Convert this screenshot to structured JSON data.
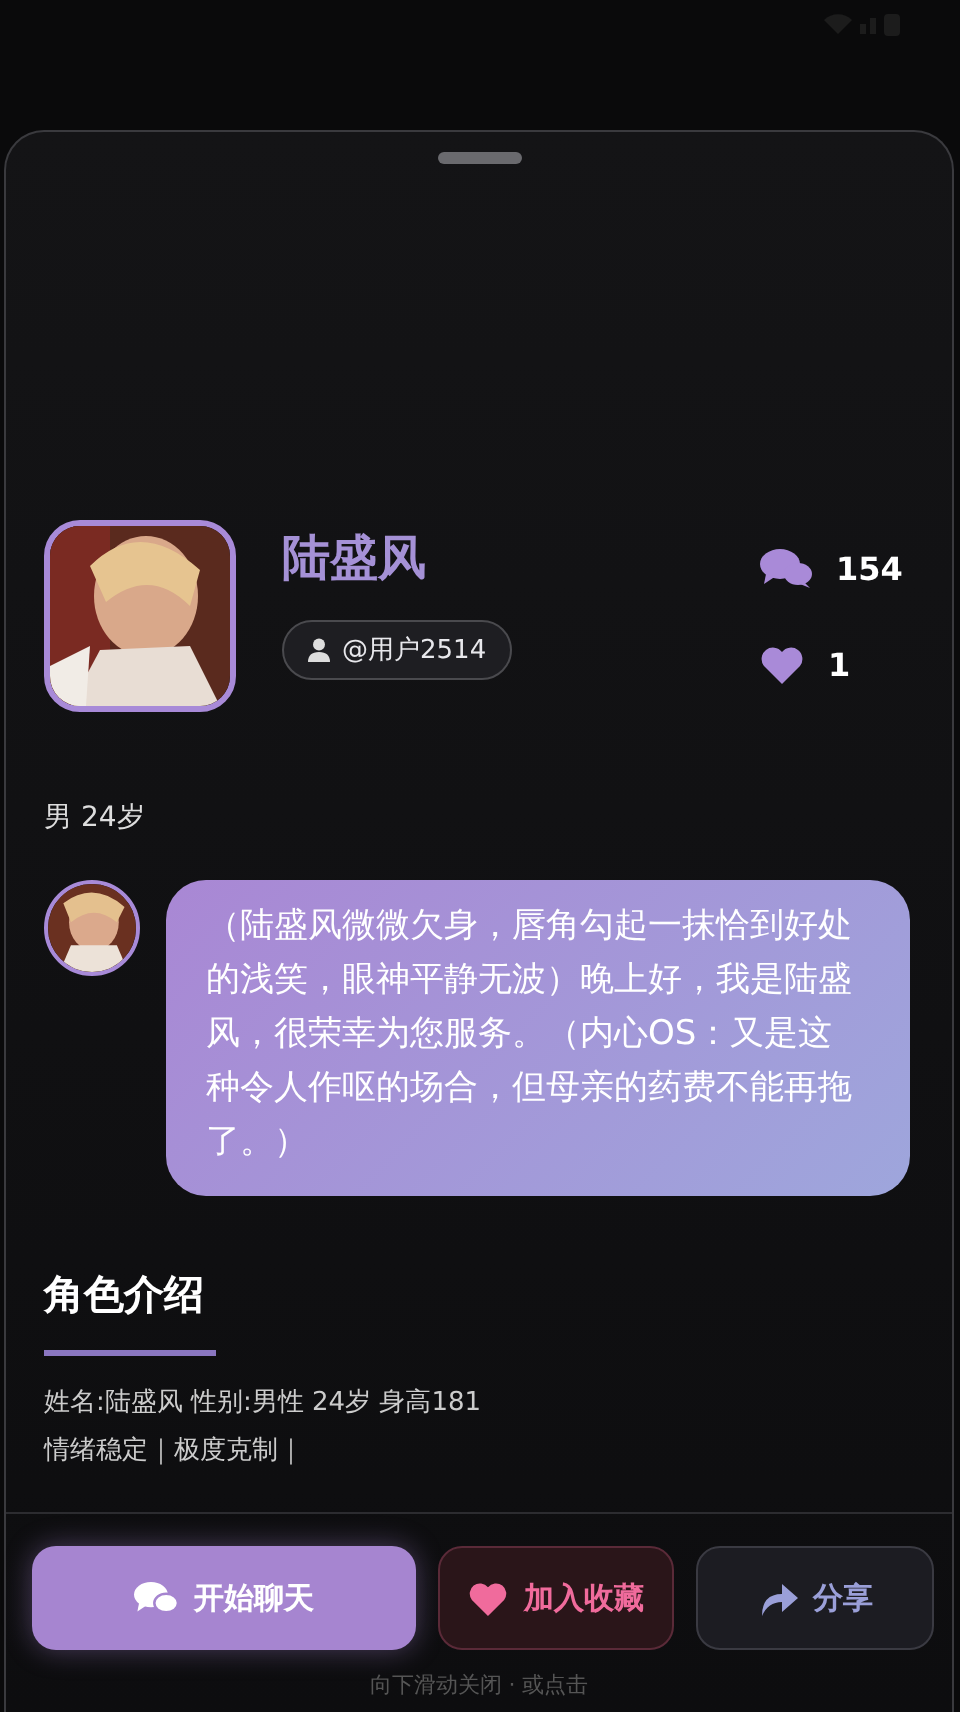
{
  "profile": {
    "name": "陆盛风",
    "creator_tag": "@用户2514",
    "stats": [
      {
        "kind": "chats",
        "value": "154"
      },
      {
        "kind": "likes",
        "value": "1"
      }
    ],
    "gender_age": "男 24岁"
  },
  "greeting": {
    "text": "（陆盛风微微欠身，唇角勾起一抹恰到好处的浅笑，眼神平静无波）晚上好，我是陆盛风，很荣幸为您服务。（内心OS：又是这种令人作呕的场合，但母亲的药费不能再拖了。）"
  },
  "intro": {
    "title": "角色介绍",
    "lines": [
      "姓名:陆盛风 性别:男性 24岁 身高181",
      "情绪稳定｜极度克制｜"
    ]
  },
  "actions": [
    {
      "kind": "chat",
      "label": "开始聊天"
    },
    {
      "kind": "favorite",
      "label": "加入收藏"
    },
    {
      "kind": "share",
      "label": "分享"
    }
  ],
  "hint": "向下滑动关闭 · 或点击"
}
